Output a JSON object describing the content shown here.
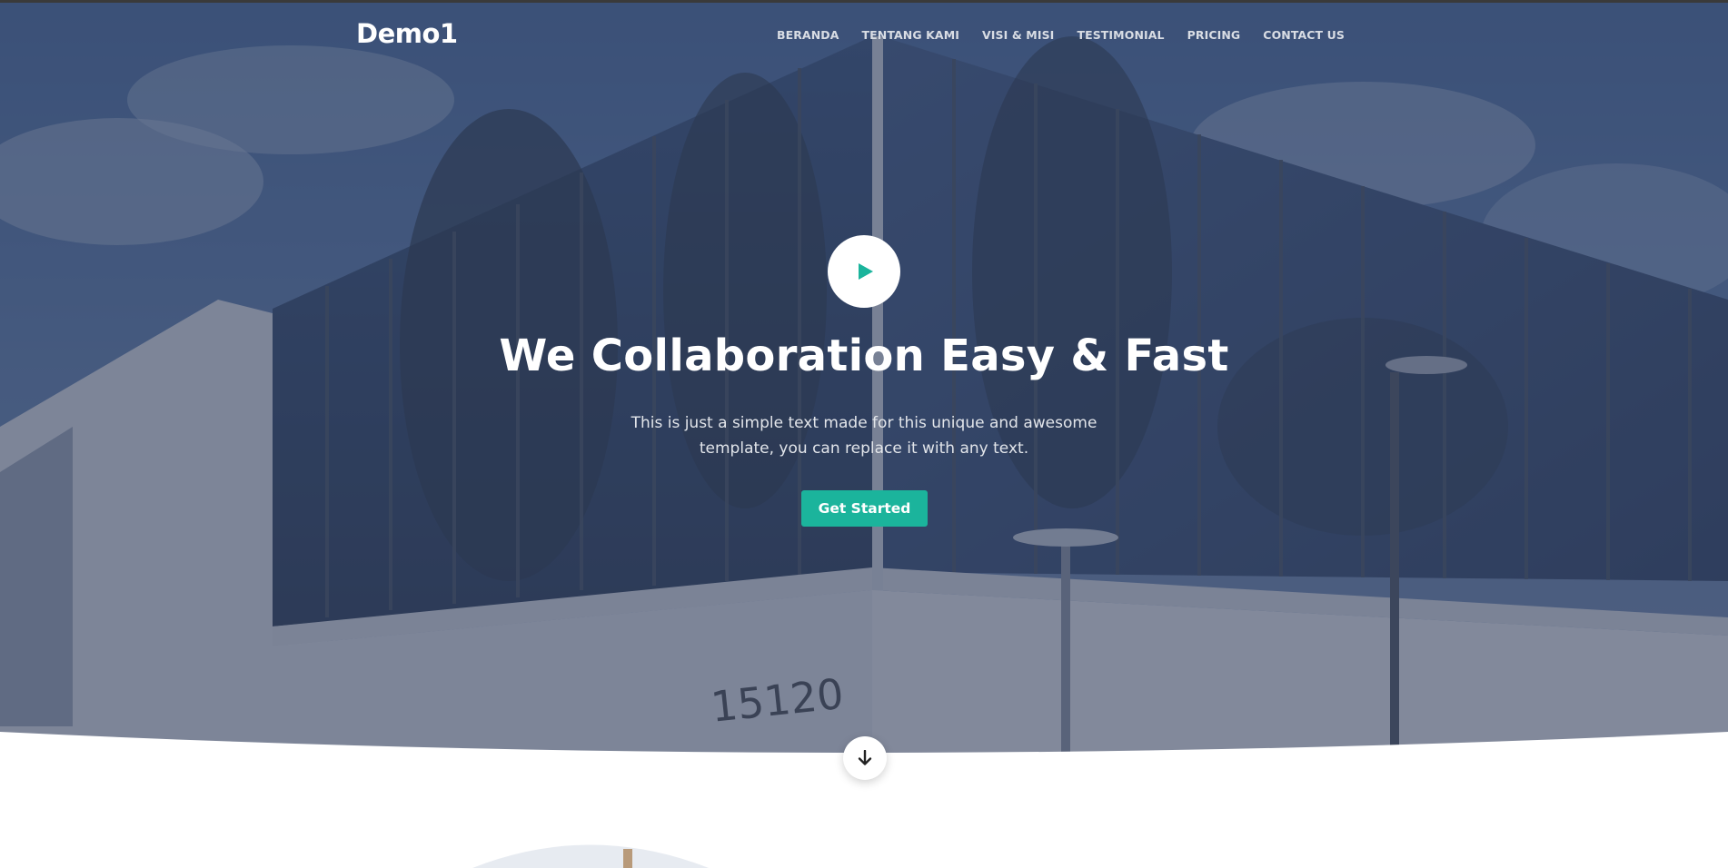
{
  "brand": {
    "logo_text": "Demo1"
  },
  "nav": {
    "items": [
      {
        "label": "BERANDA"
      },
      {
        "label": "TENTANG KAMI"
      },
      {
        "label": "VISI & MISI"
      },
      {
        "label": "TESTIMONIAL"
      },
      {
        "label": "PRICING"
      },
      {
        "label": "CONTACT US"
      }
    ]
  },
  "hero": {
    "play_icon": "play-icon",
    "headline": "We Collaboration Easy & Fast",
    "subtext": "This is just a simple text made for this unique and awesome template, you can replace it with any text.",
    "cta_label": "Get Started",
    "building_number": "15120"
  },
  "scroll": {
    "icon": "arrow-down-icon"
  },
  "colors": {
    "accent": "#1bb49c",
    "overlay": "#3a4560",
    "text_light": "#ffffff"
  }
}
